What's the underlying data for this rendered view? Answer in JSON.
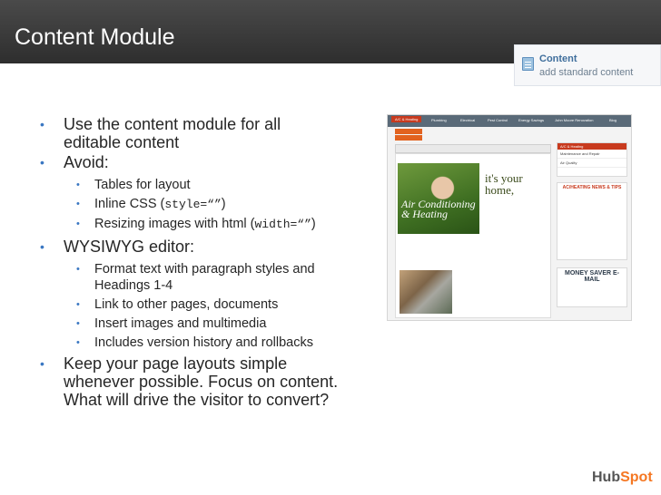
{
  "slide": {
    "title": "Content Module"
  },
  "content_widget": {
    "title": "Content",
    "subtitle": "add standard content",
    "icon": "document-icon"
  },
  "bullets": {
    "b1_line1": "Use the content module for all",
    "b1_line2": "editable content",
    "b2": "Avoid:",
    "b2_sub1": "Tables for layout",
    "b2_sub2_pre": "Inline CSS (",
    "b2_sub2_code": "style=“”",
    "b2_sub2_post": ")",
    "b2_sub3_pre": "Resizing images with html (",
    "b2_sub3_code": "width=“”",
    "b2_sub3_post": ")",
    "b3": "WYSIWYG editor:",
    "b3_sub1_line1": "Format text with paragraph styles and",
    "b3_sub1_line2": "Headings 1-4",
    "b3_sub2": "Link to other pages, documents",
    "b3_sub3": "Insert images and multimedia",
    "b3_sub4": "Includes version history and rollbacks",
    "b4_line1": "Keep your page layouts simple",
    "b4_line2": "whenever possible. Focus on content.",
    "b4_line3": "What will drive the visitor to convert?"
  },
  "screenshot": {
    "nav": [
      "A/C & Heating",
      "Plumbing",
      "Electrical",
      "Pest Control",
      "Energy Savings",
      "John Moore Renovation",
      "Blog"
    ],
    "hero_tagline_1": "it's your",
    "hero_tagline_2": "home,",
    "hero_overlay_1": "Air Conditioning",
    "hero_overlay_2": "& Heating",
    "side_head": "A/C & Heating",
    "side_rows": [
      "Maintenance and Repair",
      "Air Quality"
    ],
    "side_title": "AC/HEATING NEWS & TIPS",
    "money_title": "MONEY SAVER E-MAIL"
  },
  "footer": {
    "logo_part1": "Hub",
    "logo_part2": "Spot"
  },
  "colors": {
    "title_bar": "#3a3a3a",
    "bullet": "#3a77c2",
    "accent_orange": "#f57722"
  }
}
